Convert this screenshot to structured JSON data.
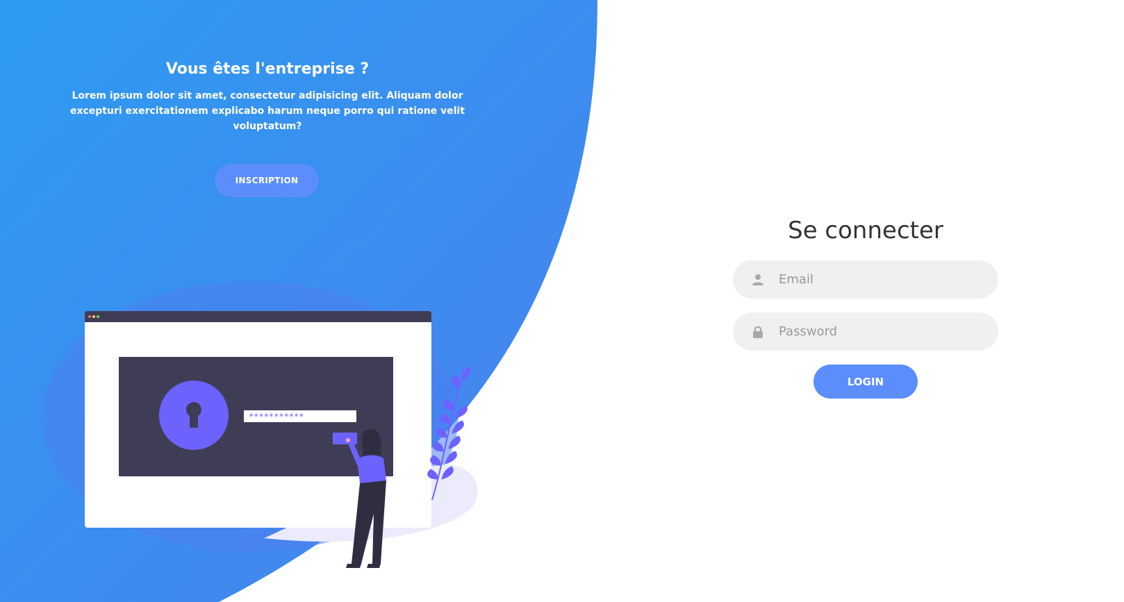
{
  "colors": {
    "gradient_start": "#2d9bf0",
    "gradient_end": "#4285f0",
    "button": "#5b8dfb",
    "illustration_purple": "#6c63ff",
    "illustration_dark": "#3f3d56",
    "field_bg": "#f0f0f0"
  },
  "promo": {
    "title": "Vous êtes l'entreprise ?",
    "text": "Lorem ipsum dolor sit amet, consectetur adipisicing elit. Aliquam dolor excepturi exercitationem explicabo harum neque porro qui ratione velit voluptatum?",
    "button_label": "INSCRIPTION"
  },
  "illustration": {
    "password_mask": "***********",
    "icons": [
      "keyhole-icon",
      "person-illustration",
      "plant-illustration"
    ]
  },
  "login": {
    "title": "Se connecter",
    "email_placeholder": "Email",
    "email_icon": "user-icon",
    "password_placeholder": "Password",
    "password_icon": "lock-icon",
    "button_label": "LOGIN"
  }
}
